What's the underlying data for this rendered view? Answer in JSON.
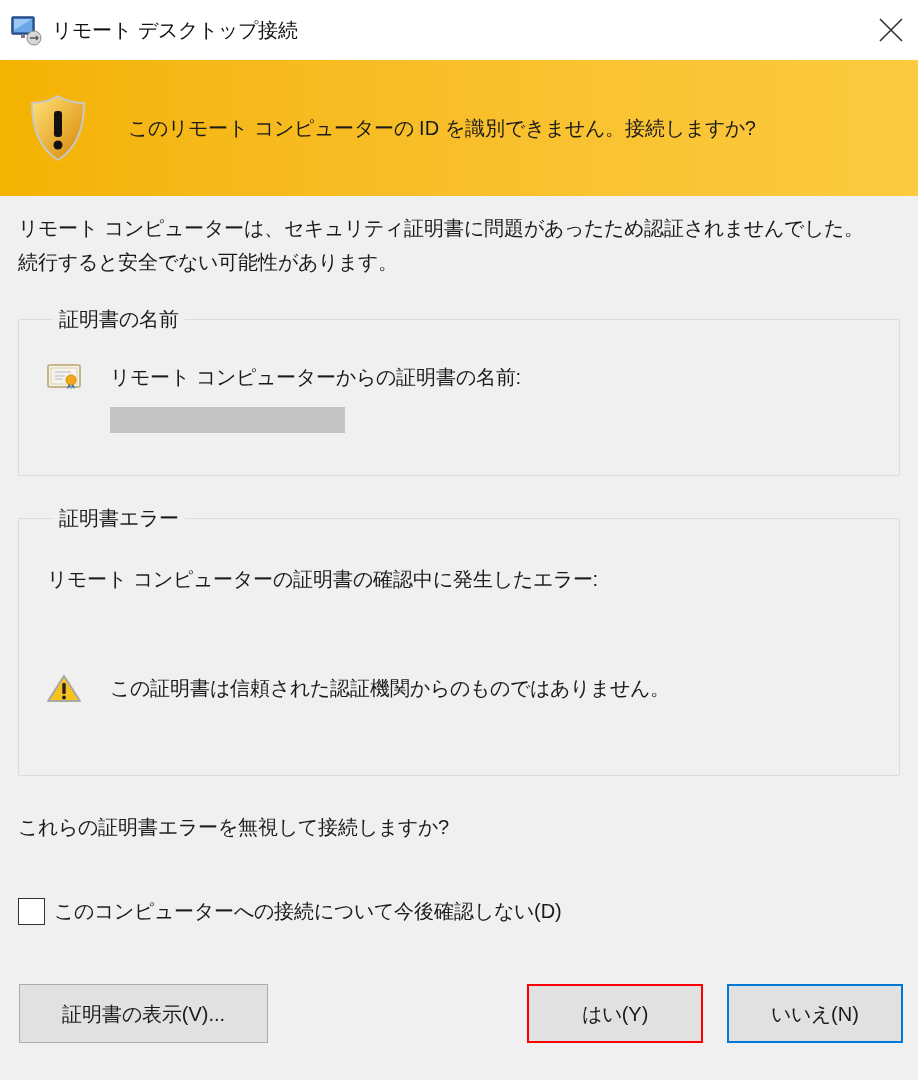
{
  "window": {
    "title": "リモート デスクトップ接続"
  },
  "banner": {
    "text": "このリモート コンピューターの ID を識別できません。接続しますか?"
  },
  "message": "リモート コンピューターは、セキュリティ証明書に問題があったため認証されませんでした。続行すると安全でない可能性があります。",
  "cert_name_group": {
    "legend": "証明書の名前",
    "label": "リモート コンピューターからの証明書の名前:"
  },
  "cert_error_group": {
    "legend": "証明書エラー",
    "intro": "リモート コンピューターの証明書の確認中に発生したエラー:",
    "errors": [
      {
        "text": "この証明書は信頼された認証機関からのものではありません。"
      }
    ]
  },
  "question": "これらの証明書エラーを無視して接続しますか?",
  "checkbox": {
    "label": "このコンピューターへの接続について今後確認しない(D)",
    "checked": false
  },
  "buttons": {
    "left": [
      {
        "label": "証明書の表示(V)...",
        "default": false,
        "highlighted": false
      }
    ],
    "right": [
      {
        "label": "はい(Y)",
        "default": false,
        "highlighted": true
      },
      {
        "label": "いいえ(N)",
        "default": true,
        "highlighted": false
      }
    ]
  }
}
